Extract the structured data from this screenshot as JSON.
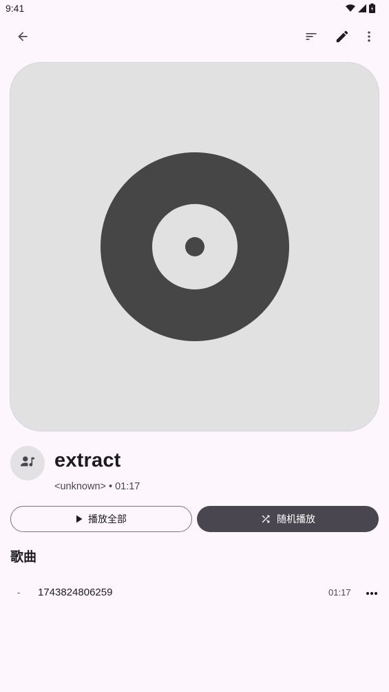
{
  "status_bar": {
    "time": "9:41",
    "icons": [
      "wifi-icon",
      "signal-icon",
      "battery-icon"
    ]
  },
  "top_bar": {
    "actions": [
      "back-arrow-icon",
      "sort-icon",
      "edit-icon",
      "more-vert-icon"
    ]
  },
  "album": {
    "artwork_icon": "vinyl-record-icon",
    "artist_icon": "artist-music-icon",
    "title": "extract",
    "artist": "<unknown>",
    "separator": "•",
    "duration": "01:17"
  },
  "buttons": {
    "play_all_label": "播放全部",
    "shuffle_label": "随机播放"
  },
  "songs_section": {
    "title": "歌曲",
    "items": [
      {
        "track": "-",
        "title": "1743824806259",
        "duration": "01:17"
      }
    ]
  },
  "colors": {
    "background": "#fdf7fd",
    "artwork_bg": "#e1e1e1",
    "artwork_fg": "#464646",
    "primary_button": "#4a4650"
  }
}
